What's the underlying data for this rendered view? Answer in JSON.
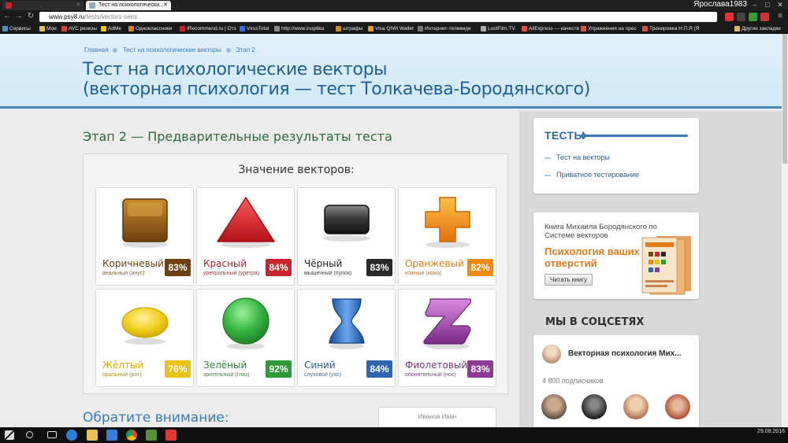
{
  "browser": {
    "tabs": [
      {
        "label": "",
        "active": false
      },
      {
        "label": "Тест на психологически...",
        "active": true
      }
    ],
    "user": "Ярослава1983",
    "url_host": "www.psy8.ru",
    "url_path": "/tests/vectors-semi",
    "bookmarks": [
      "Сервисы",
      "Мои",
      "AVC резизы",
      "AdMe",
      "Одноклассники",
      "IRecommend.ru | Отз",
      "VirusTotal",
      "http://www.inoptika",
      "штрафы",
      "Visa QIWI Wallet",
      "Интернет-телевиде",
      "LostFilm.TV.",
      "AliExpress — качеств",
      "Упражнения на прес",
      "Тренировка Н.П.Я (Я",
      "Другие закладки"
    ]
  },
  "breadcrumbs": [
    "Главная",
    "Тест на психологические векторы",
    "Этап 2"
  ],
  "page_title_line1": "Тест на психологические векторы",
  "page_title_line2": "(векторная психология — тест Толкачева-Бородянского)",
  "section_title": "Этап 2 — Предварительные результаты теста",
  "panel_title": "Значение векторов:",
  "vectors": [
    {
      "name": "Коричневый",
      "sub": "анальный (анус)",
      "pct": "83%",
      "color": "#7a4a12",
      "text_color": "#6e4210"
    },
    {
      "name": "Красный",
      "sub": "уретральный (уретра)",
      "pct": "84%",
      "color": "#c8262c",
      "text_color": "#b82028"
    },
    {
      "name": "Чёрный",
      "sub": "мышечный (пупок)",
      "pct": "83%",
      "color": "#2a2a2a",
      "text_color": "#1e1e1e"
    },
    {
      "name": "Оранжевый",
      "sub": "кожный (кожа)",
      "pct": "82%",
      "color": "#ee8a10",
      "text_color": "#e0800e"
    },
    {
      "name": "Жёлтый",
      "sub": "оральный (рот)",
      "pct": "76%",
      "color": "#e9c21a",
      "text_color": "#d9a90a"
    },
    {
      "name": "Зелёный",
      "sub": "зрительный (глаз)",
      "pct": "92%",
      "color": "#2f9a3a",
      "text_color": "#278a32"
    },
    {
      "name": "Синий",
      "sub": "слуховой (ухо)",
      "pct": "84%",
      "color": "#2f66b0",
      "text_color": "#2a5ea5"
    },
    {
      "name": "Фиолетовый",
      "sub": "обонятельный (нос)",
      "pct": "83%",
      "color": "#8e3a95",
      "text_color": "#7e3186"
    }
  ],
  "notice_title": "Обратите внимание:",
  "name_card": "Иванов Иван",
  "sidebar": {
    "tests_title": "ТЕСТЫ",
    "tests_links": [
      "Тест на векторы",
      "Приватное тестирование"
    ],
    "book_text": "Книга Михаила Бородянского по Системе векторов",
    "book_big": "Психология ваших отверстий",
    "book_button": "Читать книгу",
    "social_title": "МЫ В СОЦСЕТЯХ",
    "vk_name": "Векторная психология Мих...",
    "vk_subs": "4 800 подписчиков"
  },
  "taskbar": {
    "time": "",
    "date": "29.08.2016"
  }
}
